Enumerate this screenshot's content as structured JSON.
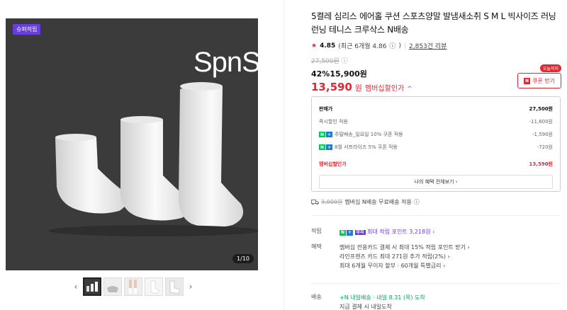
{
  "image": {
    "badge": "슈퍼적립",
    "brand": "SpnS",
    "brand_mark": "®",
    "counter": "1/10"
  },
  "thumbs": {
    "prev": "‹",
    "next": "›"
  },
  "product": {
    "title": "5켤레 심리스 에어홀 쿠션 스포츠양말 발냄새소취 S M L 빅사이즈 러닝 런닝 테니스 크루삭스 N배송",
    "rating_star": "★",
    "rating": "4.85",
    "rating_detail": "(최근 6개월 4.86",
    "rating_info": "ⓘ",
    "rating_close": ")",
    "reviews": "2,853건 리뷰",
    "original_price": "27,500원",
    "discount": "42%15,900원",
    "member_price": "13,590",
    "member_unit": "원",
    "member_label": "멤버십할인가",
    "caret": "^"
  },
  "coupon": {
    "today": "오늘까지",
    "icon": "N",
    "label": "쿠폰 받기"
  },
  "breakdown": {
    "rows": [
      {
        "label": "판매가",
        "value": "27,500원"
      },
      {
        "label": "즉시할인 적용",
        "value": "-11,600원"
      },
      {
        "label": "주말배송_일요일 10% 쿠폰 적용",
        "value": "-1,590원"
      },
      {
        "label": "8월 서프라이즈 5% 쿠폰 적용",
        "value": "-720원"
      }
    ],
    "total_label": "멤버십할인가",
    "total_value": "13,590원",
    "button": "나의 혜택 전체보기 ›"
  },
  "ship_fee": {
    "old": "3,000원",
    "text": "멤버십 N배송 무료배송 적용",
    "info": "ⓘ"
  },
  "points": {
    "label": "적립",
    "text": "최대 적립 포인트 3,218원 ›"
  },
  "benefits": {
    "label": "혜택",
    "lines": [
      "멤버십 전용카드 결제 시 최대 15% 적립 포인트 받기 ›",
      "라인프렌즈 카드 최대 271원 추가 적립(2%) ›",
      "최대 6개월 무이자 할부 · 60개월 특별금리 ›"
    ]
  },
  "delivery": {
    "label": "배송",
    "badge": "+N 내일배송",
    "date": "· 내일 8.31 (목) 도착",
    "sub": "지금 결제 시 내일도착"
  },
  "colors": {
    "accent": "#e5252f",
    "purple": "#6a3ddf",
    "green": "#03c75a"
  }
}
